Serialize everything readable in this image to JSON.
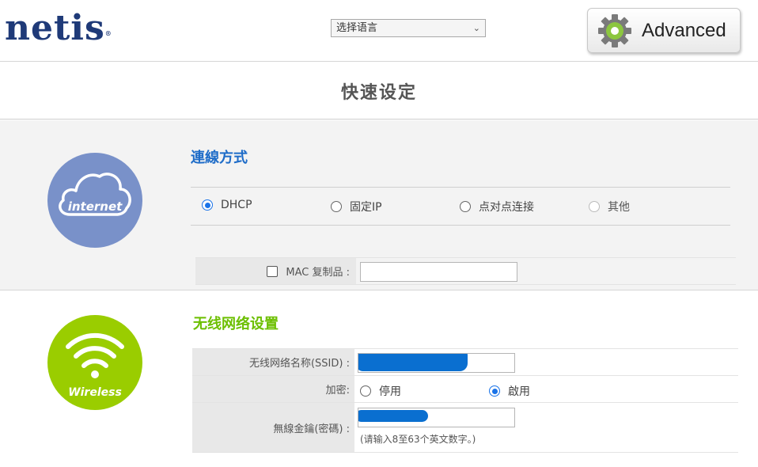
{
  "header": {
    "logo": "netis",
    "language_select": {
      "selected": "选择语言"
    },
    "advanced_label": "Advanced"
  },
  "title": "快速设定",
  "internet": {
    "icon_label": "internet",
    "heading": "連線方式",
    "options": [
      {
        "label": "DHCP",
        "checked": true
      },
      {
        "label": "固定IP",
        "checked": false
      },
      {
        "label": "点对点连接",
        "checked": false
      },
      {
        "label": "其他",
        "checked": false,
        "disabled": true
      }
    ],
    "mac_clone_label": "MAC 复制品 :",
    "mac_clone_checked": false,
    "mac_value": ""
  },
  "wireless": {
    "icon_label": "Wireless",
    "heading": "无线网络设置",
    "ssid_label": "无线网络名称(SSID) :",
    "encryption_label": "加密:",
    "encryption_options": [
      {
        "label": "停用",
        "checked": false
      },
      {
        "label": "啟用",
        "checked": true
      }
    ],
    "key_label": "無線金鑰(密碼) :",
    "key_hint": "(请输入8至63个英文数字。)"
  },
  "colors": {
    "brand_blue": "#1f3a78",
    "heading_blue": "#1e6cc8",
    "heading_green": "#6cbf00",
    "internet_circle": "#7991c9",
    "wireless_circle": "#9acd00",
    "radio_accent": "#1a73e8",
    "redaction": "#0a6fd0"
  }
}
